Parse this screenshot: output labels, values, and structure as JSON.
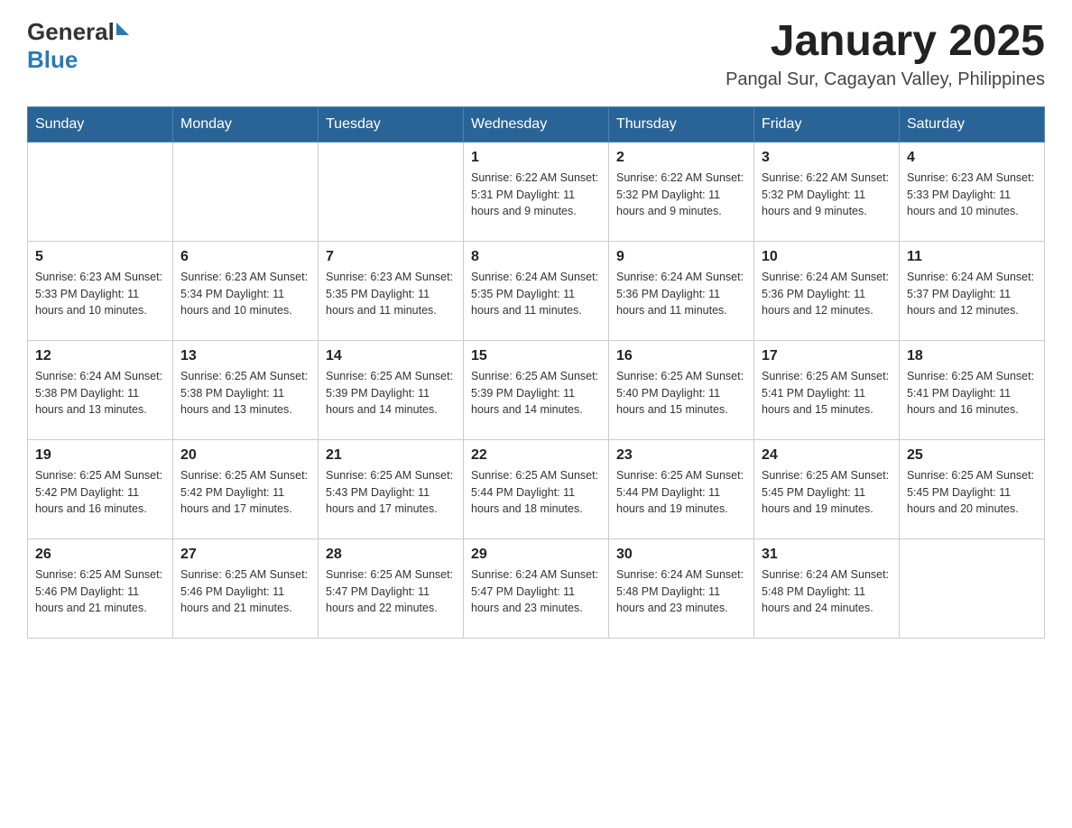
{
  "header": {
    "logo_general": "General",
    "logo_blue": "Blue",
    "month_title": "January 2025",
    "location": "Pangal Sur, Cagayan Valley, Philippines"
  },
  "weekdays": [
    "Sunday",
    "Monday",
    "Tuesday",
    "Wednesday",
    "Thursday",
    "Friday",
    "Saturday"
  ],
  "weeks": [
    [
      {
        "day": "",
        "info": ""
      },
      {
        "day": "",
        "info": ""
      },
      {
        "day": "",
        "info": ""
      },
      {
        "day": "1",
        "info": "Sunrise: 6:22 AM\nSunset: 5:31 PM\nDaylight: 11 hours and 9 minutes."
      },
      {
        "day": "2",
        "info": "Sunrise: 6:22 AM\nSunset: 5:32 PM\nDaylight: 11 hours and 9 minutes."
      },
      {
        "day": "3",
        "info": "Sunrise: 6:22 AM\nSunset: 5:32 PM\nDaylight: 11 hours and 9 minutes."
      },
      {
        "day": "4",
        "info": "Sunrise: 6:23 AM\nSunset: 5:33 PM\nDaylight: 11 hours and 10 minutes."
      }
    ],
    [
      {
        "day": "5",
        "info": "Sunrise: 6:23 AM\nSunset: 5:33 PM\nDaylight: 11 hours and 10 minutes."
      },
      {
        "day": "6",
        "info": "Sunrise: 6:23 AM\nSunset: 5:34 PM\nDaylight: 11 hours and 10 minutes."
      },
      {
        "day": "7",
        "info": "Sunrise: 6:23 AM\nSunset: 5:35 PM\nDaylight: 11 hours and 11 minutes."
      },
      {
        "day": "8",
        "info": "Sunrise: 6:24 AM\nSunset: 5:35 PM\nDaylight: 11 hours and 11 minutes."
      },
      {
        "day": "9",
        "info": "Sunrise: 6:24 AM\nSunset: 5:36 PM\nDaylight: 11 hours and 11 minutes."
      },
      {
        "day": "10",
        "info": "Sunrise: 6:24 AM\nSunset: 5:36 PM\nDaylight: 11 hours and 12 minutes."
      },
      {
        "day": "11",
        "info": "Sunrise: 6:24 AM\nSunset: 5:37 PM\nDaylight: 11 hours and 12 minutes."
      }
    ],
    [
      {
        "day": "12",
        "info": "Sunrise: 6:24 AM\nSunset: 5:38 PM\nDaylight: 11 hours and 13 minutes."
      },
      {
        "day": "13",
        "info": "Sunrise: 6:25 AM\nSunset: 5:38 PM\nDaylight: 11 hours and 13 minutes."
      },
      {
        "day": "14",
        "info": "Sunrise: 6:25 AM\nSunset: 5:39 PM\nDaylight: 11 hours and 14 minutes."
      },
      {
        "day": "15",
        "info": "Sunrise: 6:25 AM\nSunset: 5:39 PM\nDaylight: 11 hours and 14 minutes."
      },
      {
        "day": "16",
        "info": "Sunrise: 6:25 AM\nSunset: 5:40 PM\nDaylight: 11 hours and 15 minutes."
      },
      {
        "day": "17",
        "info": "Sunrise: 6:25 AM\nSunset: 5:41 PM\nDaylight: 11 hours and 15 minutes."
      },
      {
        "day": "18",
        "info": "Sunrise: 6:25 AM\nSunset: 5:41 PM\nDaylight: 11 hours and 16 minutes."
      }
    ],
    [
      {
        "day": "19",
        "info": "Sunrise: 6:25 AM\nSunset: 5:42 PM\nDaylight: 11 hours and 16 minutes."
      },
      {
        "day": "20",
        "info": "Sunrise: 6:25 AM\nSunset: 5:42 PM\nDaylight: 11 hours and 17 minutes."
      },
      {
        "day": "21",
        "info": "Sunrise: 6:25 AM\nSunset: 5:43 PM\nDaylight: 11 hours and 17 minutes."
      },
      {
        "day": "22",
        "info": "Sunrise: 6:25 AM\nSunset: 5:44 PM\nDaylight: 11 hours and 18 minutes."
      },
      {
        "day": "23",
        "info": "Sunrise: 6:25 AM\nSunset: 5:44 PM\nDaylight: 11 hours and 19 minutes."
      },
      {
        "day": "24",
        "info": "Sunrise: 6:25 AM\nSunset: 5:45 PM\nDaylight: 11 hours and 19 minutes."
      },
      {
        "day": "25",
        "info": "Sunrise: 6:25 AM\nSunset: 5:45 PM\nDaylight: 11 hours and 20 minutes."
      }
    ],
    [
      {
        "day": "26",
        "info": "Sunrise: 6:25 AM\nSunset: 5:46 PM\nDaylight: 11 hours and 21 minutes."
      },
      {
        "day": "27",
        "info": "Sunrise: 6:25 AM\nSunset: 5:46 PM\nDaylight: 11 hours and 21 minutes."
      },
      {
        "day": "28",
        "info": "Sunrise: 6:25 AM\nSunset: 5:47 PM\nDaylight: 11 hours and 22 minutes."
      },
      {
        "day": "29",
        "info": "Sunrise: 6:24 AM\nSunset: 5:47 PM\nDaylight: 11 hours and 23 minutes."
      },
      {
        "day": "30",
        "info": "Sunrise: 6:24 AM\nSunset: 5:48 PM\nDaylight: 11 hours and 23 minutes."
      },
      {
        "day": "31",
        "info": "Sunrise: 6:24 AM\nSunset: 5:48 PM\nDaylight: 11 hours and 24 minutes."
      },
      {
        "day": "",
        "info": ""
      }
    ]
  ]
}
